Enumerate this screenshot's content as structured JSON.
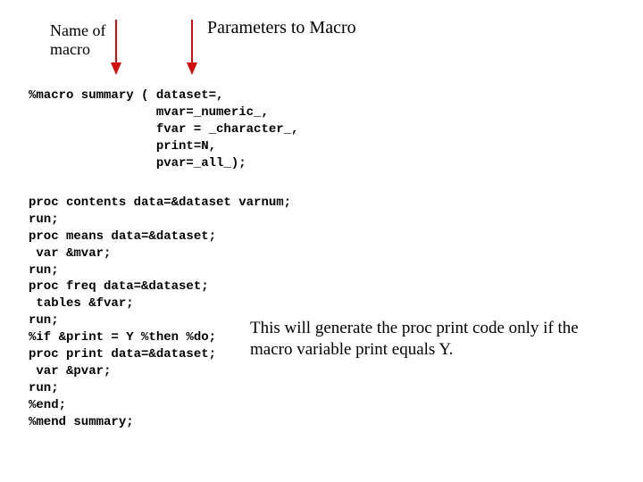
{
  "labels": {
    "name_of_macro": "Name of\nmacro",
    "parameters": "Parameters to Macro"
  },
  "code_header": "%macro summary ( dataset=,\n                 mvar=_numeric_,\n                 fvar = _character_,\n                 print=N,\n                 pvar=_all_);",
  "code_body": "proc contents data=&dataset varnum;\nrun;\nproc means data=&dataset;\n var &mvar;\nrun;\nproc freq data=&dataset;\n tables &fvar;\nrun;\n%if &print = Y %then %do;\nproc print data=&dataset;\n var &pvar;\nrun;\n%end;\n%mend summary;",
  "annotation": "This will generate the proc print code only if the macro variable print equals Y.",
  "colors": {
    "arrow": "#d30e0e"
  }
}
